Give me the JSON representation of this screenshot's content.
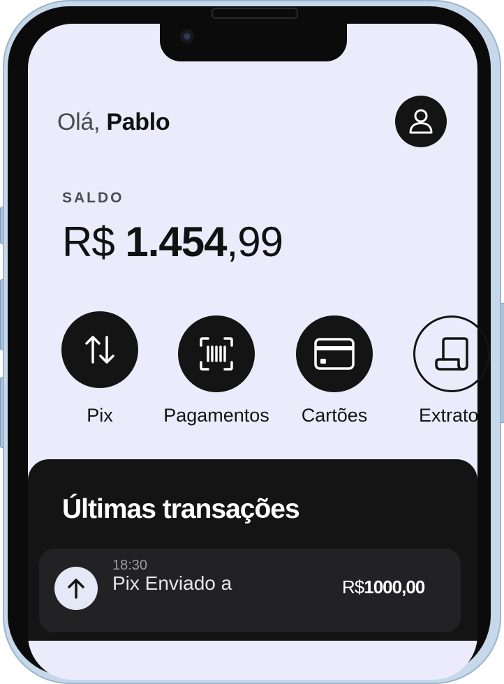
{
  "greeting": {
    "prefix": "Olá,",
    "name": "Pablo"
  },
  "balance": {
    "label": "SALDO",
    "currency": "R$",
    "integer": "1.454",
    "cents": ",99"
  },
  "actions": [
    {
      "label": "Pix",
      "icon": "arrows-up-down-icon"
    },
    {
      "label": "Pagamentos",
      "icon": "barcode-scan-icon"
    },
    {
      "label": "Cartões",
      "icon": "credit-card-icon"
    },
    {
      "label": "Extrato",
      "icon": "receipt-icon"
    }
  ],
  "transactions": {
    "title": "Últimas transações",
    "items": [
      {
        "time": "18:30",
        "description": "Pix Enviado a",
        "currency": "R$",
        "amount": "1000,00",
        "icon": "arrow-up-icon"
      }
    ]
  },
  "colors": {
    "background": "#ebebfc",
    "dark": "#141414",
    "card": "#222224"
  }
}
